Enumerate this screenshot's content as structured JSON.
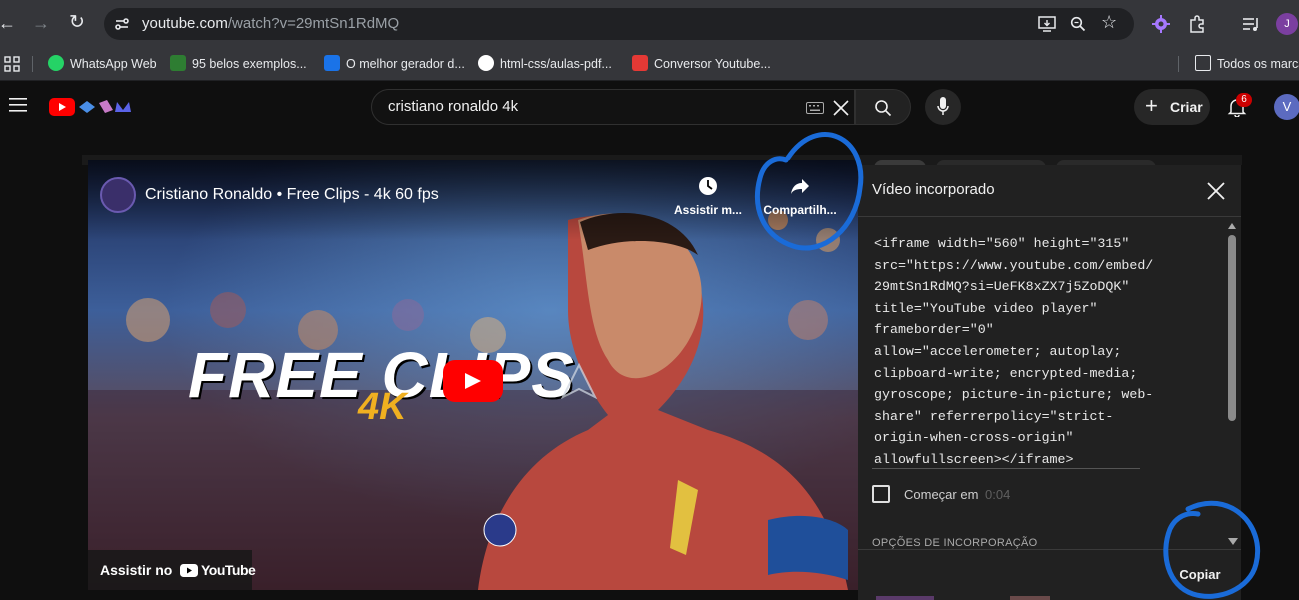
{
  "browser": {
    "url_host": "youtube.com",
    "url_path": "/watch?v=29mtSn1RdMQ",
    "profile_initial": "J",
    "bookmarks": [
      {
        "label": "WhatsApp Web",
        "icon": "whatsapp-icon",
        "color": "#25d366"
      },
      {
        "label": "95 belos exemplos...",
        "icon": "site-icon",
        "color": "#2e7d32"
      },
      {
        "label": "O melhor gerador d...",
        "icon": "site-icon",
        "color": "#1a73e8"
      },
      {
        "label": "html-css/aulas-pdf...",
        "icon": "github-icon",
        "color": "#ffffff"
      },
      {
        "label": "Conversor Youtube...",
        "icon": "site-icon",
        "color": "#e53935"
      }
    ],
    "bookmarks_folder": "Todos os marca"
  },
  "youtube": {
    "search_query": "cristiano ronaldo 4k",
    "create_label": "Criar",
    "notification_count": "6",
    "avatar_initial": "V"
  },
  "video": {
    "title": "Cristiano Ronaldo • Free Clips - 4k 60 fps",
    "watch_later_label": "Assistir m...",
    "share_label": "Compartilh...",
    "thumb_text": "FREE CLIPS",
    "thumb_sub": "4K",
    "watch_on_label": "Assistir no",
    "watch_on_brand": "YouTube"
  },
  "embed_panel": {
    "title": "Vídeo incorporado",
    "code_lines": [
      "<iframe width=\"560\" height=\"315\"",
      "src=\"https://www.youtube.com/embed/",
      "29mtSn1RdMQ?si=UeFK8xZX7j5ZoDQK\"",
      "title=\"YouTube video player\"",
      "frameborder=\"0\"",
      "allow=\"accelerometer; autoplay;",
      "clipboard-write; encrypted-media;",
      "gyroscope; picture-in-picture; web-",
      "share\" referrerpolicy=\"strict-",
      "origin-when-cross-origin\"",
      "allowfullscreen></iframe>"
    ],
    "start_at_label": "Começar em",
    "start_at_time": "0:04",
    "options_label": "OPÇÕES DE INCORPORAÇÃO",
    "copy_label": "Copiar"
  }
}
